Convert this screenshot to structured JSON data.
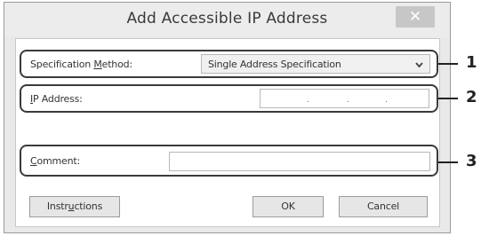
{
  "dialog": {
    "title": "Add Accessible IP Address",
    "close_symbol": "✕",
    "close_icon": "close-icon"
  },
  "form": {
    "specification_method": {
      "label_pre": "Specification ",
      "label_accel": "M",
      "label_post": "ethod:",
      "value": "Single Address Specification"
    },
    "ip_address": {
      "label_pre": "",
      "label_accel": "I",
      "label_post": "P Address:",
      "separators": [
        ".",
        ".",
        "."
      ]
    },
    "comment": {
      "label_pre": "",
      "label_accel": "C",
      "label_post": "omment:",
      "value": ""
    }
  },
  "buttons": {
    "instructions_pre": "Instr",
    "instructions_accel": "u",
    "instructions_post": "ctions",
    "ok": "OK",
    "cancel": "Cancel"
  },
  "callouts": [
    "1",
    "2",
    "3"
  ],
  "colors": {
    "frame": "#e9e9e9",
    "callout": "#222222"
  }
}
